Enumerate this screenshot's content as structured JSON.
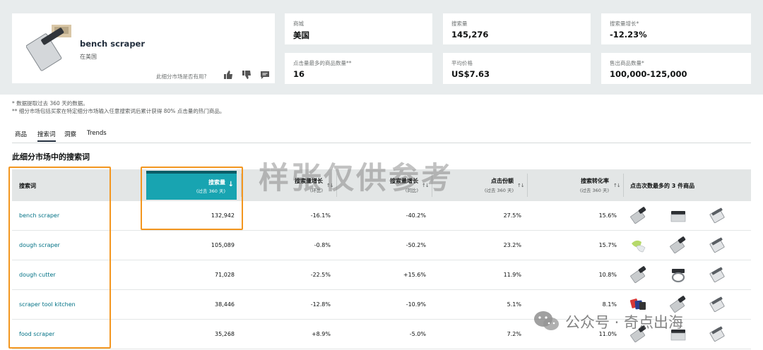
{
  "product": {
    "name": "bench scraper",
    "location": "在美国",
    "feedback_question": "此细分市场是否有用?"
  },
  "stats": [
    {
      "label": "商城",
      "value": "美国"
    },
    {
      "label": "搜索量",
      "value": "145,276"
    },
    {
      "label": "搜索量增长*",
      "value": "-12.23%"
    },
    {
      "label": "点击量最多的商品数量**",
      "value": "16"
    },
    {
      "label": "平均价格",
      "value": "US$7.63"
    },
    {
      "label": "售出商品数量*",
      "value": "100,000-125,000"
    }
  ],
  "notes": [
    "* 数据提取过去 360 天的数据。",
    "** 细分市场包括买家在特定细分市场输入任意搜索词后累计获得 80% 点击量的热门商品。"
  ],
  "tabs": [
    "商品",
    "搜索词",
    "洞察",
    "Trends"
  ],
  "active_tab": "搜索词",
  "section_title": "此细分市场中的搜索词",
  "watermark": "样张仅供参考",
  "table": {
    "headers": {
      "term": "搜索词",
      "volume": "搜索量",
      "volume_sub": "(过去 360 天)",
      "growth_180": "搜索量增长",
      "growth_180_sub": "(环比)",
      "growth_90": "搜索量增长",
      "growth_90_sub": "(同比)",
      "click_share": "点击份额",
      "click_share_sub": "(过去 360 天)",
      "conversion": "搜索转化率",
      "conversion_sub": "(过去 360 天)",
      "top_products": "点击次数最多的 3 件商品"
    },
    "rows": [
      {
        "term": "bench scraper",
        "volume": "132,942",
        "growth_180": "-16.1%",
        "growth_90": "-40.2%",
        "click_share": "27.5%",
        "conversion": "15.6%"
      },
      {
        "term": "dough scraper",
        "volume": "105,089",
        "growth_180": "-0.8%",
        "growth_90": "-50.2%",
        "click_share": "23.2%",
        "conversion": "15.7%"
      },
      {
        "term": "dough cutter",
        "volume": "71,028",
        "growth_180": "-22.5%",
        "growth_90": "+15.6%",
        "click_share": "11.9%",
        "conversion": "10.8%"
      },
      {
        "term": "scraper tool kitchen",
        "volume": "38,446",
        "growth_180": "-12.8%",
        "growth_90": "-10.9%",
        "click_share": "5.1%",
        "conversion": "8.1%"
      },
      {
        "term": "food scraper",
        "volume": "35,268",
        "growth_180": "+8.9%",
        "growth_90": "-5.0%",
        "click_share": "7.2%",
        "conversion": "11.0%"
      }
    ]
  },
  "wechat_label": "公众号 · 奇点出海",
  "colors": {
    "accent": "#18a4b1",
    "highlight": "#f3961f",
    "link": "#007185",
    "panel": "#e8eced"
  }
}
